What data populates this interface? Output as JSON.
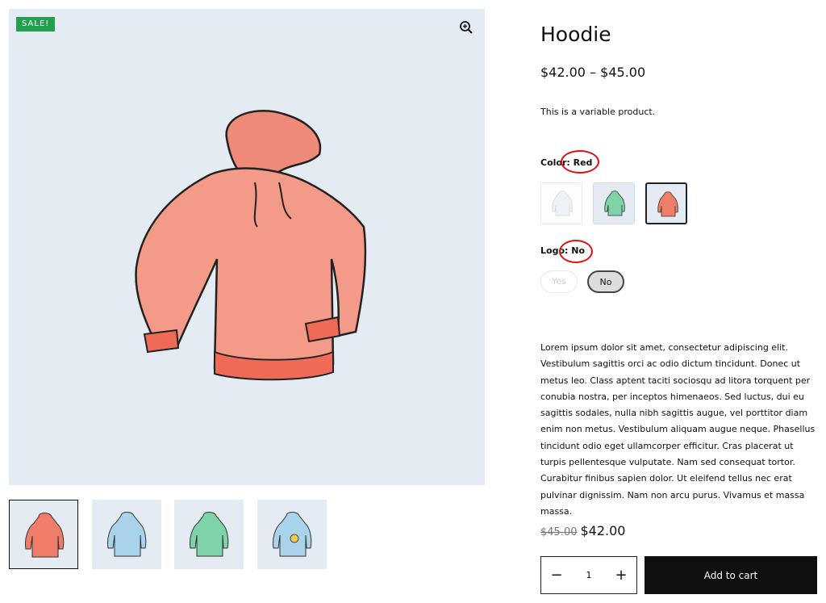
{
  "gallery": {
    "badge": "SALE!",
    "thumbnail_colors": [
      "#f07d6a",
      "#a9d3ea",
      "#7fd3a8",
      "#a9d3ea"
    ],
    "zoom_icon": "zoom-in-icon"
  },
  "product": {
    "title": "Hoodie",
    "price_range": "$42.00 – $45.00",
    "short_description": "This is a variable product.",
    "color_label": "Color",
    "color_value": "Red",
    "color_options": [
      {
        "color": "#dfe9f2",
        "state": "disabled"
      },
      {
        "color": "#7fd3a8",
        "state": "available"
      },
      {
        "color": "#f07d6a",
        "state": "selected"
      }
    ],
    "logo_label": "Logo",
    "logo_value": "No",
    "logo_options": [
      "Yes",
      "No"
    ],
    "long_description": "Lorem ipsum dolor sit amet, consectetur adipiscing elit. Vestibulum sagittis orci ac odio dictum tincidunt. Donec ut metus leo. Class aptent taciti sociosqu ad litora torquent per conubia nostra, per inceptos himenaeos. Sed luctus, dui eu sagittis sodales, nulla nibh sagittis augue, vel porttitor diam enim non metus. Vestibulum aliquam augue neque. Phasellus tincidunt odio eget ullamcorper efficitur. Cras placerat ut turpis pellentesque vulputate. Nam sed consequat tortor. Curabitur finibus sapien dolor. Ut eleifend tellus nec erat pulvinar dignissim. Nam non arcu purus. Vivamus et massa massa.",
    "old_price": "$45.00",
    "sale_price": "$42.00",
    "quantity": "1",
    "add_to_cart_label": "Add to cart"
  },
  "colors": {
    "sale_badge": "#22a04f",
    "annotation_circle": "#e01010",
    "button_dark": "#0f0f10",
    "gallery_bg": "#e5ebf2"
  }
}
